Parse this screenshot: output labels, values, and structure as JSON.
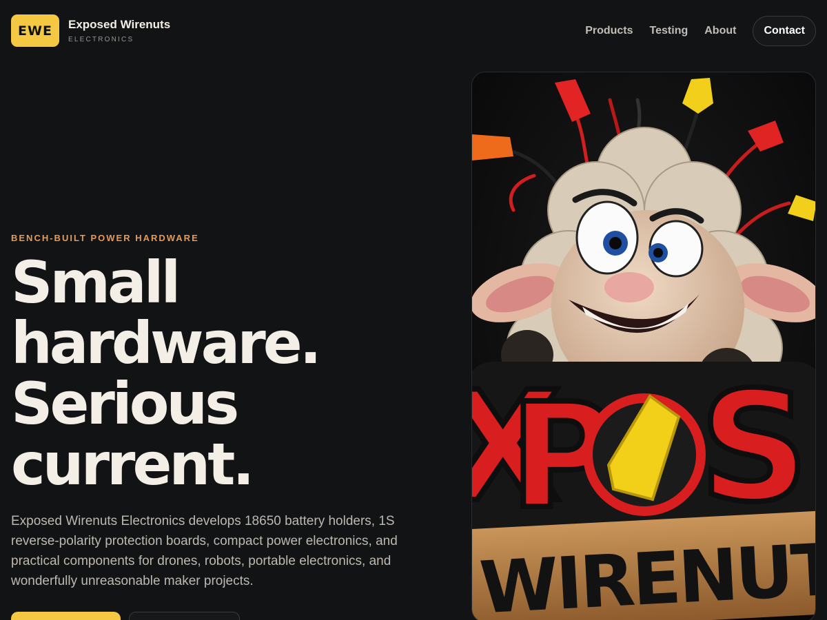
{
  "brand": {
    "badge": "EWE",
    "name": "Exposed Wirenuts",
    "tagline": "ELECTRONICS",
    "accent_color": "#f4c842"
  },
  "nav": {
    "links": [
      "Products",
      "Testing",
      "About"
    ],
    "contact_label": "Contact"
  },
  "hero": {
    "eyebrow": "BENCH-BUILT POWER HARDWARE",
    "eyebrow_color": "#e59a57",
    "headline": [
      "Small",
      "hardware.",
      "Serious",
      "current."
    ],
    "intro": "Exposed Wirenuts Electronics develops 18650 battery holders, 1S reverse-polarity protection boards, compact power electronics, and practical components for drones, robots, portable electronics, and wonderfully unreasonable maker projects.",
    "primary_cta": "",
    "secondary_cta": "",
    "image": {
      "description_icon": "sheep-mascot-illustration",
      "sign_text": "EXPOS WIRENUTS"
    }
  }
}
